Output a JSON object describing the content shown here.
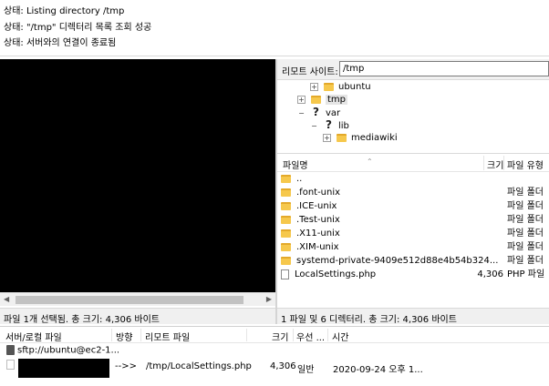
{
  "status_log": [
    "상태: Listing directory /tmp",
    "상태: \"/tmp\" 디렉터리 목록 조회 성공",
    "상태: 서버와의 연결이 종료됨"
  ],
  "remote": {
    "site_label": "리모트 사이트:",
    "path": "/tmp",
    "tree": [
      {
        "label": "ubuntu",
        "icon": "folder",
        "expander": "plus"
      },
      {
        "label": "tmp",
        "icon": "folder",
        "expander": "plus",
        "selected": true
      },
      {
        "label": "var",
        "icon": "question",
        "expander": "expanded"
      },
      {
        "label": "lib",
        "icon": "question",
        "expander": "plus"
      },
      {
        "label": "mediawiki",
        "icon": "folder",
        "expander": "plus"
      }
    ],
    "columns": {
      "name": "파일명",
      "size": "크기",
      "type": "파일 유형"
    },
    "files": [
      {
        "name": "..",
        "size": "",
        "type": "",
        "icon": "folder"
      },
      {
        "name": ".font-unix",
        "size": "",
        "type": "파일 폴더",
        "icon": "folder"
      },
      {
        "name": ".ICE-unix",
        "size": "",
        "type": "파일 폴더",
        "icon": "folder"
      },
      {
        "name": ".Test-unix",
        "size": "",
        "type": "파일 폴더",
        "icon": "folder"
      },
      {
        "name": ".X11-unix",
        "size": "",
        "type": "파일 폴더",
        "icon": "folder"
      },
      {
        "name": ".XIM-unix",
        "size": "",
        "type": "파일 폴더",
        "icon": "folder"
      },
      {
        "name": "systemd-private-9409e512d88e4b54b324...",
        "size": "",
        "type": "파일 폴더",
        "icon": "folder"
      },
      {
        "name": "LocalSettings.php",
        "size": "4,306",
        "type": "PHP 파일",
        "icon": "file"
      }
    ],
    "status": "1 파일 및 6 디렉터리. 총 크기: 4,306 바이트"
  },
  "local": {
    "status": "파일 1개 선택됨. 총 크기: 4,306 바이트"
  },
  "queue": {
    "columns": {
      "server_local": "서버/로컬 파일",
      "direction": "방향",
      "remote_file": "리모트 파일",
      "size": "크기",
      "priority": "우선 ...",
      "time": "시간"
    },
    "server": "sftp://ubuntu@ec2-1...",
    "item": {
      "direction": "-->>",
      "remote_file": "/tmp/LocalSettings.php",
      "size": "4,306",
      "priority": "일반",
      "time": "2020-09-24 오후 1..."
    }
  }
}
